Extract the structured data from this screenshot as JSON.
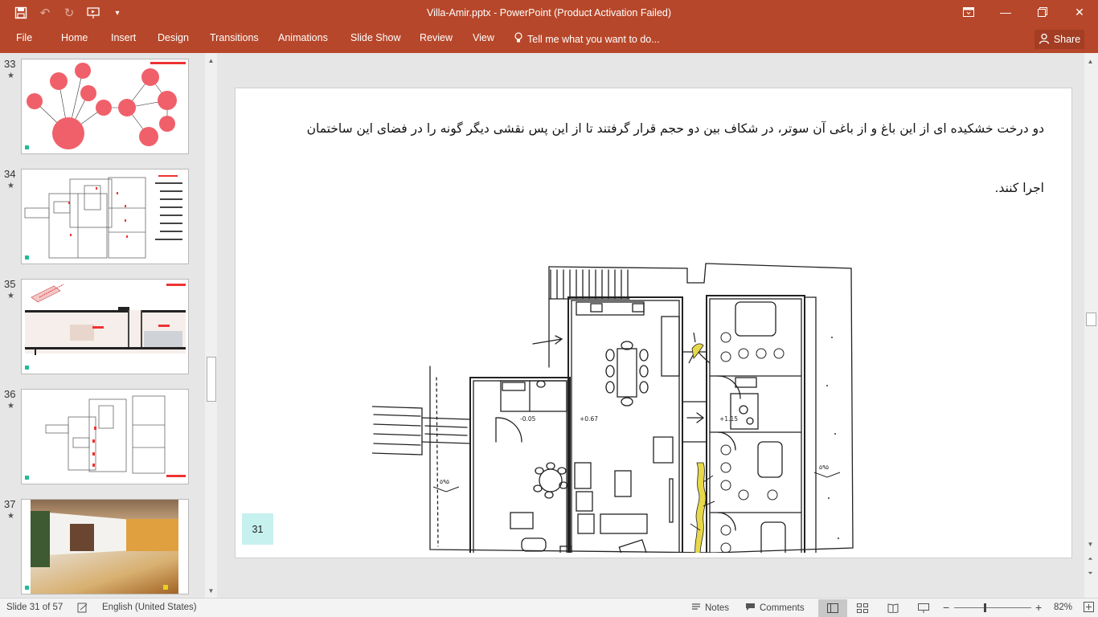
{
  "window": {
    "title": "Villa-Amir.pptx - PowerPoint (Product Activation Failed)",
    "qat_icons": [
      "save-icon",
      "undo-icon",
      "redo-icon",
      "start-from-beginning-icon",
      "customize-qat-icon"
    ],
    "controls": [
      "restore-ribbon-icon",
      "maximize-icon",
      "close-icon"
    ]
  },
  "ribbon": {
    "tabs": [
      "File",
      "Home",
      "Insert",
      "Design",
      "Transitions",
      "Animations",
      "Slide Show",
      "Review",
      "View"
    ],
    "tell_me": "Tell me what you want to do...",
    "share": "Share"
  },
  "thumbnails": [
    {
      "number": "33",
      "star": "★"
    },
    {
      "number": "34",
      "star": "★"
    },
    {
      "number": "35",
      "star": "★"
    },
    {
      "number": "36",
      "star": "★"
    },
    {
      "number": "37",
      "star": "★"
    }
  ],
  "slide": {
    "line1": "دو درخت خشکیده ای از این باغ و از باغی آن سوتر، در شکاف بین دو حجم قرار گرفتند تا از این پس نقشی دیگر گونه را در فضای این ساختمان",
    "line2": "اجرا کنند.",
    "page_number": "31",
    "plan_labels": {
      "level1": "-0.05",
      "level2": "+0.67",
      "level3": "+1.15",
      "left_tag": "۵۹۵",
      "right_tag": "۵۹۵"
    },
    "accent": "#e8d84a"
  },
  "statusbar": {
    "slide_info": "Slide 31 of 57",
    "language": "English (United States)",
    "notes": "Notes",
    "comments": "Comments",
    "zoom": "82%",
    "zoom_fraction": 0.82
  },
  "colors": {
    "brand": "#b7472a",
    "thumb_bubble": "#f0606a"
  }
}
